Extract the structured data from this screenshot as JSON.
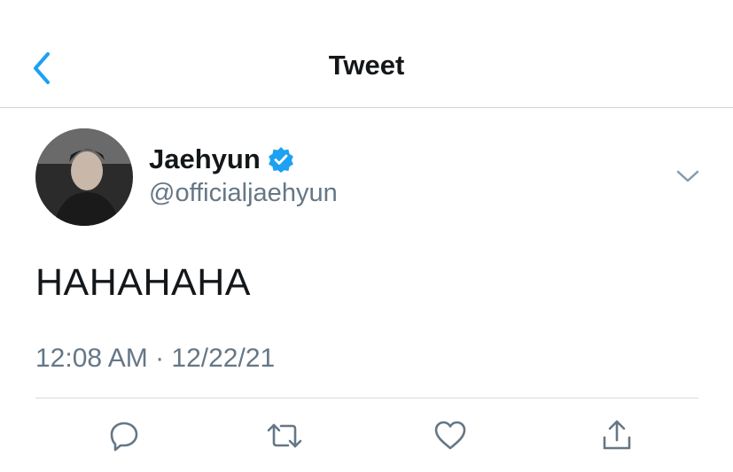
{
  "header": {
    "title": "Tweet",
    "back_icon": "chevron-left-icon"
  },
  "tweet": {
    "author_name": "Jaehyun",
    "handle": "@officialjaehyun",
    "verified": true,
    "text": "HAHAHAHA",
    "timestamp": "12:08 AM · 12/22/21"
  },
  "actions": [
    {
      "icon": "reply-icon"
    },
    {
      "icon": "retweet-icon"
    },
    {
      "icon": "like-icon"
    },
    {
      "icon": "share-icon"
    }
  ],
  "colors": {
    "accent": "#1da1f2",
    "verified": "#1da1f2",
    "secondary_text": "#657786",
    "divider": "#d6d9dc"
  }
}
